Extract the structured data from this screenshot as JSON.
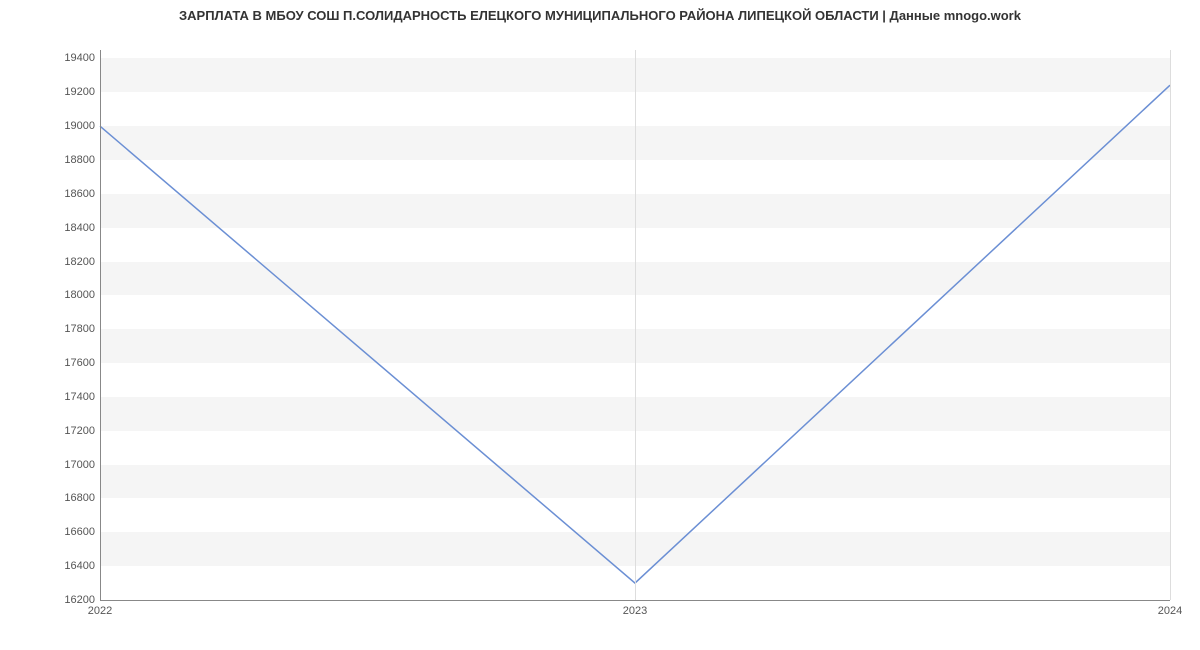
{
  "chart_data": {
    "type": "line",
    "title": "ЗАРПЛАТА В МБОУ СОШ П.СОЛИДАРНОСТЬ ЕЛЕЦКОГО МУНИЦИПАЛЬНОГО РАЙОНА ЛИПЕЦКОЙ ОБЛАСТИ | Данные mnogo.work",
    "x": [
      2022,
      2023,
      2024
    ],
    "values": [
      19000,
      16300,
      19242
    ],
    "x_ticks": [
      2022,
      2023,
      2024
    ],
    "y_ticks": [
      16200,
      16400,
      16600,
      16800,
      17000,
      17200,
      17400,
      17600,
      17800,
      18000,
      18200,
      18400,
      18600,
      18800,
      19000,
      19200,
      19400
    ],
    "xlim": [
      2022,
      2024
    ],
    "ylim": [
      16200,
      19450
    ],
    "line_color": "#6b8fd4"
  }
}
